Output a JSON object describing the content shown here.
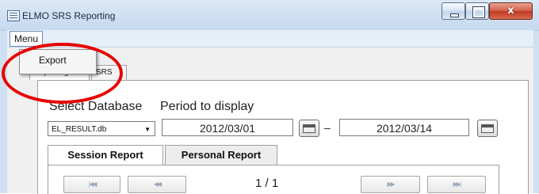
{
  "window": {
    "title": "ELMO SRS Reporting",
    "close_glyph": "x"
  },
  "menu": {
    "label": "Menu",
    "items": [
      "Export"
    ]
  },
  "tabs": [
    "Reporting",
    "SRS"
  ],
  "filters": {
    "db_label": "Select Database",
    "period_label": "Period to display",
    "database": "EL_RESULT.db",
    "date_from": "2012/03/01",
    "date_to": "2012/03/14",
    "separator": "–"
  },
  "report_tabs": [
    "Session Report",
    "Personal Report"
  ],
  "pager": {
    "page": "1 / 1"
  },
  "colors": {
    "highlight_ring": "#e60000",
    "titlebar": "#c6d9ef"
  }
}
